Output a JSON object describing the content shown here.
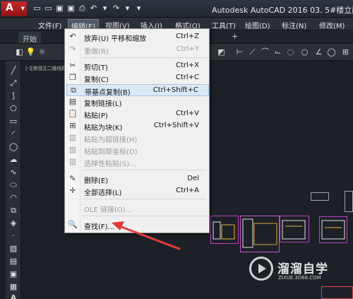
{
  "window": {
    "title": "Autodesk AutoCAD 2016     03. 5#楼立面图."
  },
  "menubar": {
    "items": [
      "文件(F)",
      "编辑(E)",
      "视图(V)",
      "插入(I)",
      "格式(O)",
      "工具(T)",
      "绘图(D)",
      "标注(N)",
      "修改(M)"
    ]
  },
  "tabs": {
    "start": "开始"
  },
  "canvas": {
    "viewport_label": "[-][俯视][二维线框]"
  },
  "edit_menu": {
    "items": [
      {
        "icon": "undo-icon",
        "label": "放弃(U) 平移和缩放",
        "shortcut": "Ctrl+Z",
        "enabled": true
      },
      {
        "icon": "redo-icon",
        "label": "重做(R)",
        "shortcut": "Ctrl+Y",
        "enabled": false
      },
      {
        "icon": "scissors-icon",
        "label": "剪切(T)",
        "shortcut": "Ctrl+X",
        "enabled": true
      },
      {
        "icon": "copy-icon",
        "label": "复制(C)",
        "shortcut": "Ctrl+C",
        "enabled": true
      },
      {
        "icon": "copy-base-icon",
        "label": "带基点复制(B)",
        "shortcut": "Ctrl+Shift+C",
        "enabled": true,
        "highlighted": true
      },
      {
        "icon": "copy-link-icon",
        "label": "复制链接(L)",
        "shortcut": "",
        "enabled": true
      },
      {
        "icon": "paste-icon",
        "label": "粘贴(P)",
        "shortcut": "Ctrl+V",
        "enabled": true
      },
      {
        "icon": "paste-block-icon",
        "label": "粘贴为块(K)",
        "shortcut": "Ctrl+Shift+V",
        "enabled": true
      },
      {
        "icon": "paste-hyperlink-icon",
        "label": "粘贴为超链接(H)",
        "shortcut": "",
        "enabled": false
      },
      {
        "icon": "paste-coords-icon",
        "label": "粘贴到原坐标(D)",
        "shortcut": "",
        "enabled": false
      },
      {
        "icon": "paste-special-icon",
        "label": "选择性粘贴(S)...",
        "shortcut": "",
        "enabled": false
      },
      {
        "icon": "erase-icon",
        "label": "删除(E)",
        "shortcut": "Del",
        "enabled": true
      },
      {
        "icon": "select-all-icon",
        "label": "全部选择(L)",
        "shortcut": "Ctrl+A",
        "enabled": true
      },
      {
        "icon": "",
        "label": "OLE 链接(O)...",
        "shortcut": "",
        "enabled": false
      },
      {
        "icon": "find-icon",
        "label": "查找(F)...",
        "shortcut": "",
        "enabled": true
      }
    ]
  },
  "watermark": {
    "name": "溜溜自学",
    "url": "ZIXUE.3D66.COM"
  },
  "colors": {
    "accent_red": "#e53a3a",
    "highlight": "#dbe8f6",
    "drawing_magenta": "#c13cc1"
  }
}
